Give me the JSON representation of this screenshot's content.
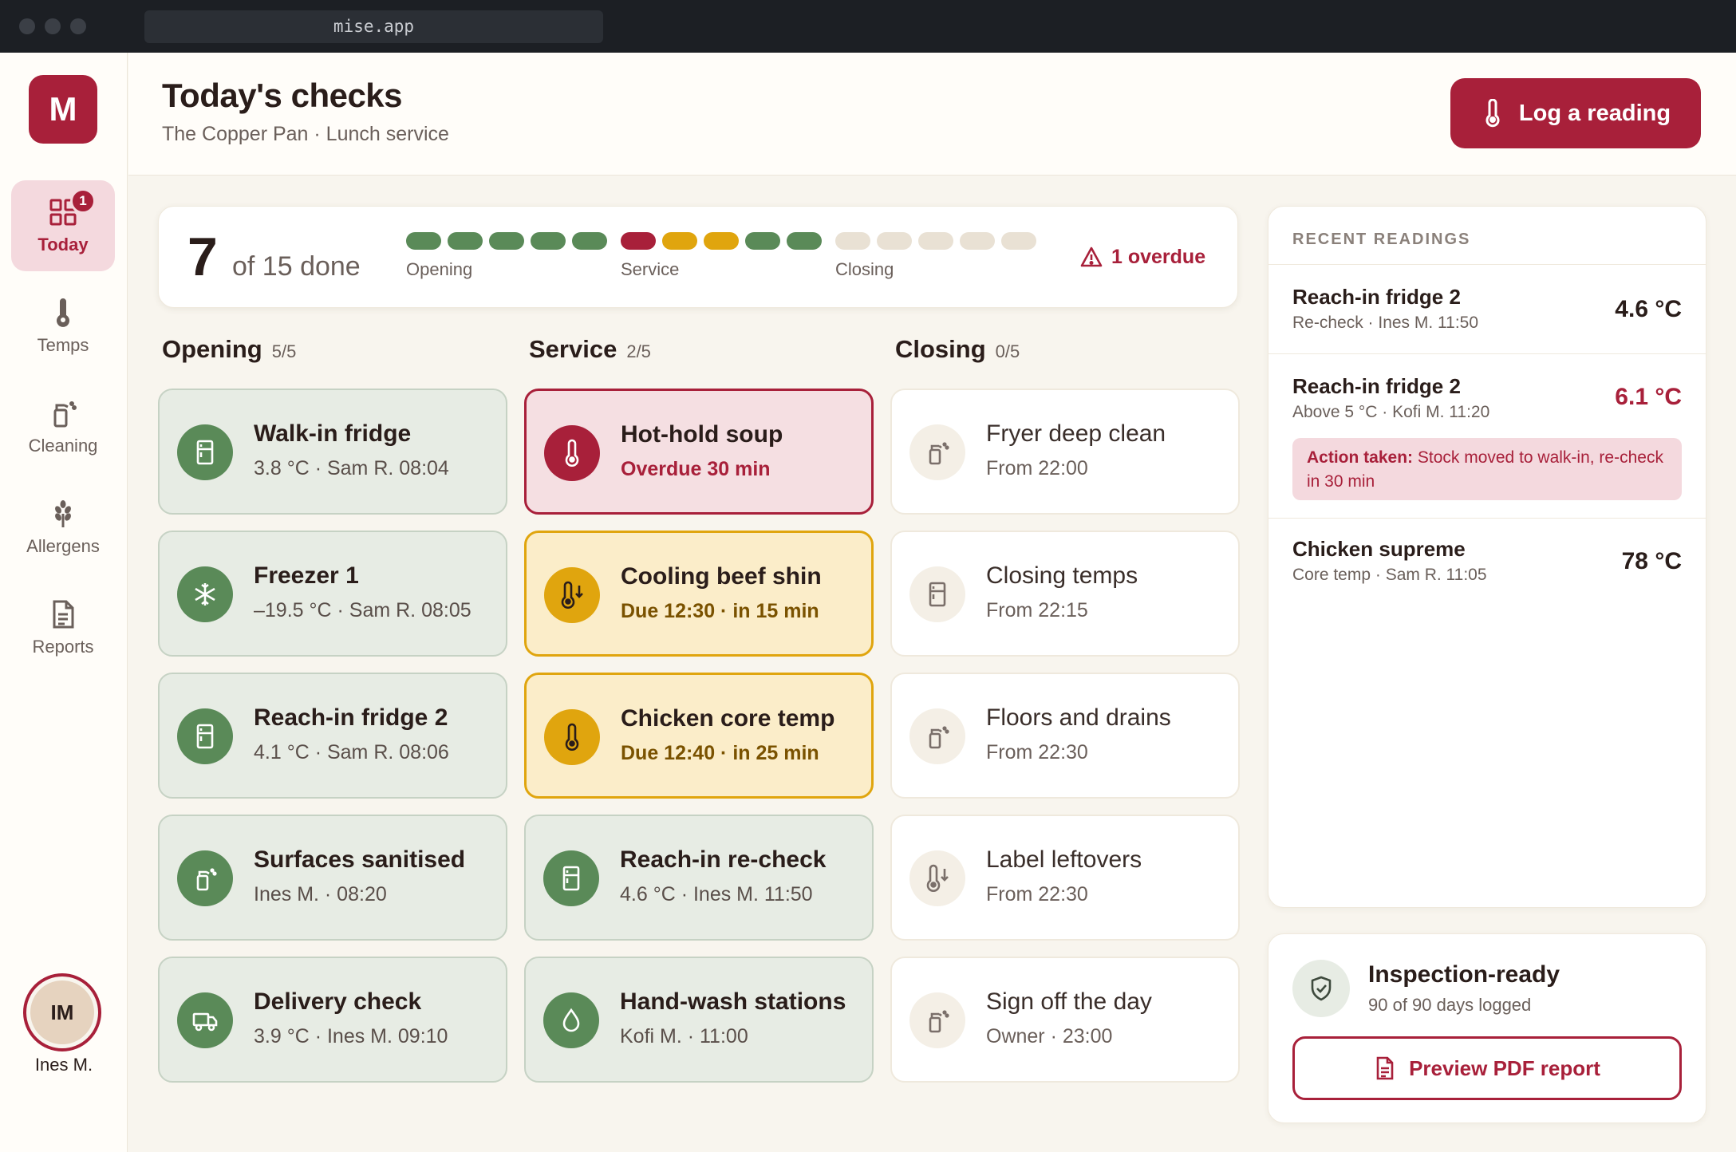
{
  "browser": {
    "url": "mise.app"
  },
  "app": {
    "logo_letter": "M"
  },
  "sidebar": {
    "items": [
      {
        "label": "Today",
        "icon": "grid-icon",
        "badge": "1",
        "active": true
      },
      {
        "label": "Temps",
        "icon": "thermometer-icon"
      },
      {
        "label": "Cleaning",
        "icon": "spray-bottle-icon"
      },
      {
        "label": "Allergens",
        "icon": "wheat-icon"
      },
      {
        "label": "Reports",
        "icon": "document-icon"
      }
    ],
    "user": {
      "initials": "IM",
      "name": "Ines M."
    }
  },
  "header": {
    "title": "Today's checks",
    "subtitle": "The Copper Pan · Lunch service",
    "log_button": "Log a reading"
  },
  "progress": {
    "done": "7",
    "total_text": "of 15 done",
    "groups": [
      {
        "label": "Opening",
        "states": [
          "done",
          "done",
          "done",
          "done",
          "done"
        ]
      },
      {
        "label": "Service",
        "states": [
          "overdue",
          "due",
          "due",
          "done",
          "done"
        ]
      },
      {
        "label": "Closing",
        "states": [
          "pending",
          "pending",
          "pending",
          "pending",
          "pending"
        ]
      }
    ],
    "overdue_text": "1 overdue"
  },
  "columns": [
    {
      "title": "Opening",
      "count": "5/5",
      "tasks": [
        {
          "title": "Walk-in fridge",
          "sub": "3.8 °C · Sam R. 08:04",
          "state": "done",
          "icon": "fridge-icon"
        },
        {
          "title": "Freezer 1",
          "sub": "–19.5 °C · Sam R. 08:05",
          "state": "done",
          "icon": "snowflake-icon"
        },
        {
          "title": "Reach-in fridge 2",
          "sub": "4.1 °C · Sam R. 08:06",
          "state": "done",
          "icon": "fridge-icon"
        },
        {
          "title": "Surfaces sanitised",
          "sub": "Ines M. · 08:20",
          "state": "done",
          "icon": "spray-bottle-icon"
        },
        {
          "title": "Delivery check",
          "sub": "3.9 °C · Ines M. 09:10",
          "state": "done",
          "icon": "truck-icon"
        }
      ]
    },
    {
      "title": "Service",
      "count": "2/5",
      "tasks": [
        {
          "title": "Hot-hold soup",
          "sub": "Overdue 30 min",
          "state": "overdue",
          "icon": "thermometer-icon"
        },
        {
          "title": "Cooling beef shin",
          "sub": "Due 12:30 · in 15 min",
          "state": "due",
          "icon": "thermometer-down-icon"
        },
        {
          "title": "Chicken core temp",
          "sub": "Due 12:40 · in 25 min",
          "state": "due",
          "icon": "thermometer-icon"
        },
        {
          "title": "Reach-in re-check",
          "sub": "4.6 °C · Ines M. 11:50",
          "state": "done",
          "icon": "fridge-icon"
        },
        {
          "title": "Hand-wash stations",
          "sub": "Kofi M. · 11:00",
          "state": "done",
          "icon": "droplet-icon"
        }
      ]
    },
    {
      "title": "Closing",
      "count": "0/5",
      "tasks": [
        {
          "title": "Fryer deep clean",
          "sub": "From 22:00",
          "state": "pending",
          "icon": "spray-bottle-icon"
        },
        {
          "title": "Closing temps",
          "sub": "From 22:15",
          "state": "pending",
          "icon": "fridge-icon"
        },
        {
          "title": "Floors and drains",
          "sub": "From 22:30",
          "state": "pending",
          "icon": "spray-bottle-icon"
        },
        {
          "title": "Label leftovers",
          "sub": "From 22:30",
          "state": "pending",
          "icon": "thermometer-down-icon"
        },
        {
          "title": "Sign off the day",
          "sub": "Owner · 23:00",
          "state": "pending",
          "icon": "spray-bottle-icon"
        }
      ]
    }
  ],
  "recent": {
    "heading": "RECENT READINGS",
    "items": [
      {
        "name": "Reach-in fridge 2",
        "meta": "Re-check · Ines M. 11:50",
        "value": "4.6 °C",
        "alert": false
      },
      {
        "name": "Reach-in fridge 2",
        "meta": "Above 5 °C · Kofi M. 11:20",
        "value": "6.1 °C",
        "alert": true,
        "action_label": "Action taken:",
        "action_text": " Stock moved to walk-in, re-check in 30 min"
      },
      {
        "name": "Chicken supreme",
        "meta": "Core temp · Sam R. 11:05",
        "value": "78 °C",
        "alert": false
      }
    ]
  },
  "inspection": {
    "title": "Inspection-ready",
    "subtitle": "90 of 90 days logged",
    "button": "Preview PDF report"
  },
  "colors": {
    "brand": "#a8203a",
    "done": "#5a8a58",
    "due": "#e0a50e",
    "pending": "#e9e1d4"
  }
}
